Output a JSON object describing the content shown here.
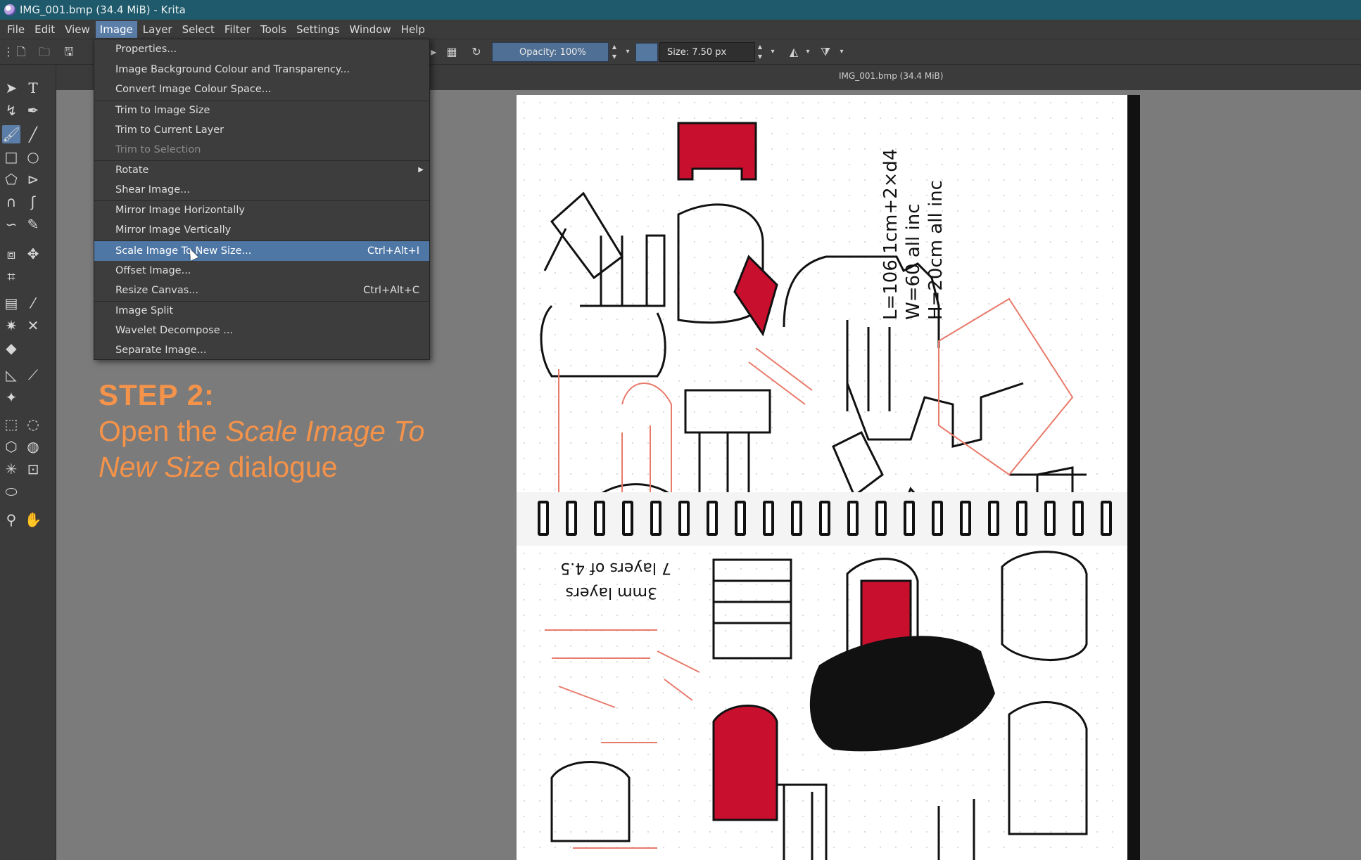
{
  "window": {
    "title": "IMG_001.bmp (34.4 MiB)  - Krita"
  },
  "menubar": [
    "File",
    "Edit",
    "View",
    "Image",
    "Layer",
    "Select",
    "Filter",
    "Tools",
    "Settings",
    "Window",
    "Help"
  ],
  "menubar_active": "Image",
  "options": {
    "opacity_label": "Opacity:  100%",
    "size_label": "Size:  7.50 px"
  },
  "tab": {
    "title": "IMG_001.bmp (34.4 MiB)"
  },
  "image_menu": {
    "items": [
      {
        "label": "Properties...",
        "shortcut": ""
      },
      {
        "label": "Image Background Colour and Transparency...",
        "shortcut": ""
      },
      {
        "label": "Convert Image Colour Space...",
        "shortcut": ""
      },
      {
        "label": "Trim to Image Size",
        "shortcut": ""
      },
      {
        "label": "Trim to Current Layer",
        "shortcut": ""
      },
      {
        "label": "Trim to Selection",
        "shortcut": "",
        "disabled": true
      },
      {
        "label": "Rotate",
        "shortcut": ""
      },
      {
        "label": "Shear Image...",
        "shortcut": ""
      },
      {
        "label": "Mirror Image Horizontally",
        "shortcut": ""
      },
      {
        "label": "Mirror Image Vertically",
        "shortcut": ""
      },
      {
        "label": "Scale Image To New Size...",
        "shortcut": "Ctrl+Alt+I"
      },
      {
        "label": "Offset Image...",
        "shortcut": ""
      },
      {
        "label": "Resize Canvas...",
        "shortcut": "Ctrl+Alt+C"
      },
      {
        "label": "Image Split",
        "shortcut": ""
      },
      {
        "label": "Wavelet Decompose ...",
        "shortcut": ""
      },
      {
        "label": "Separate Image...",
        "shortcut": ""
      }
    ],
    "highlighted": "Scale Image To New Size..."
  },
  "annotation": {
    "step": "STEP 2:",
    "line_a": "Open the ",
    "line_a_italic": "Scale Image To",
    "line_b_italic": "New Size",
    "line_b": " dialogue"
  },
  "colors": {
    "titlebar": "#1e5a6b",
    "highlight": "#4f77a5",
    "annotation": "#f5934a"
  }
}
